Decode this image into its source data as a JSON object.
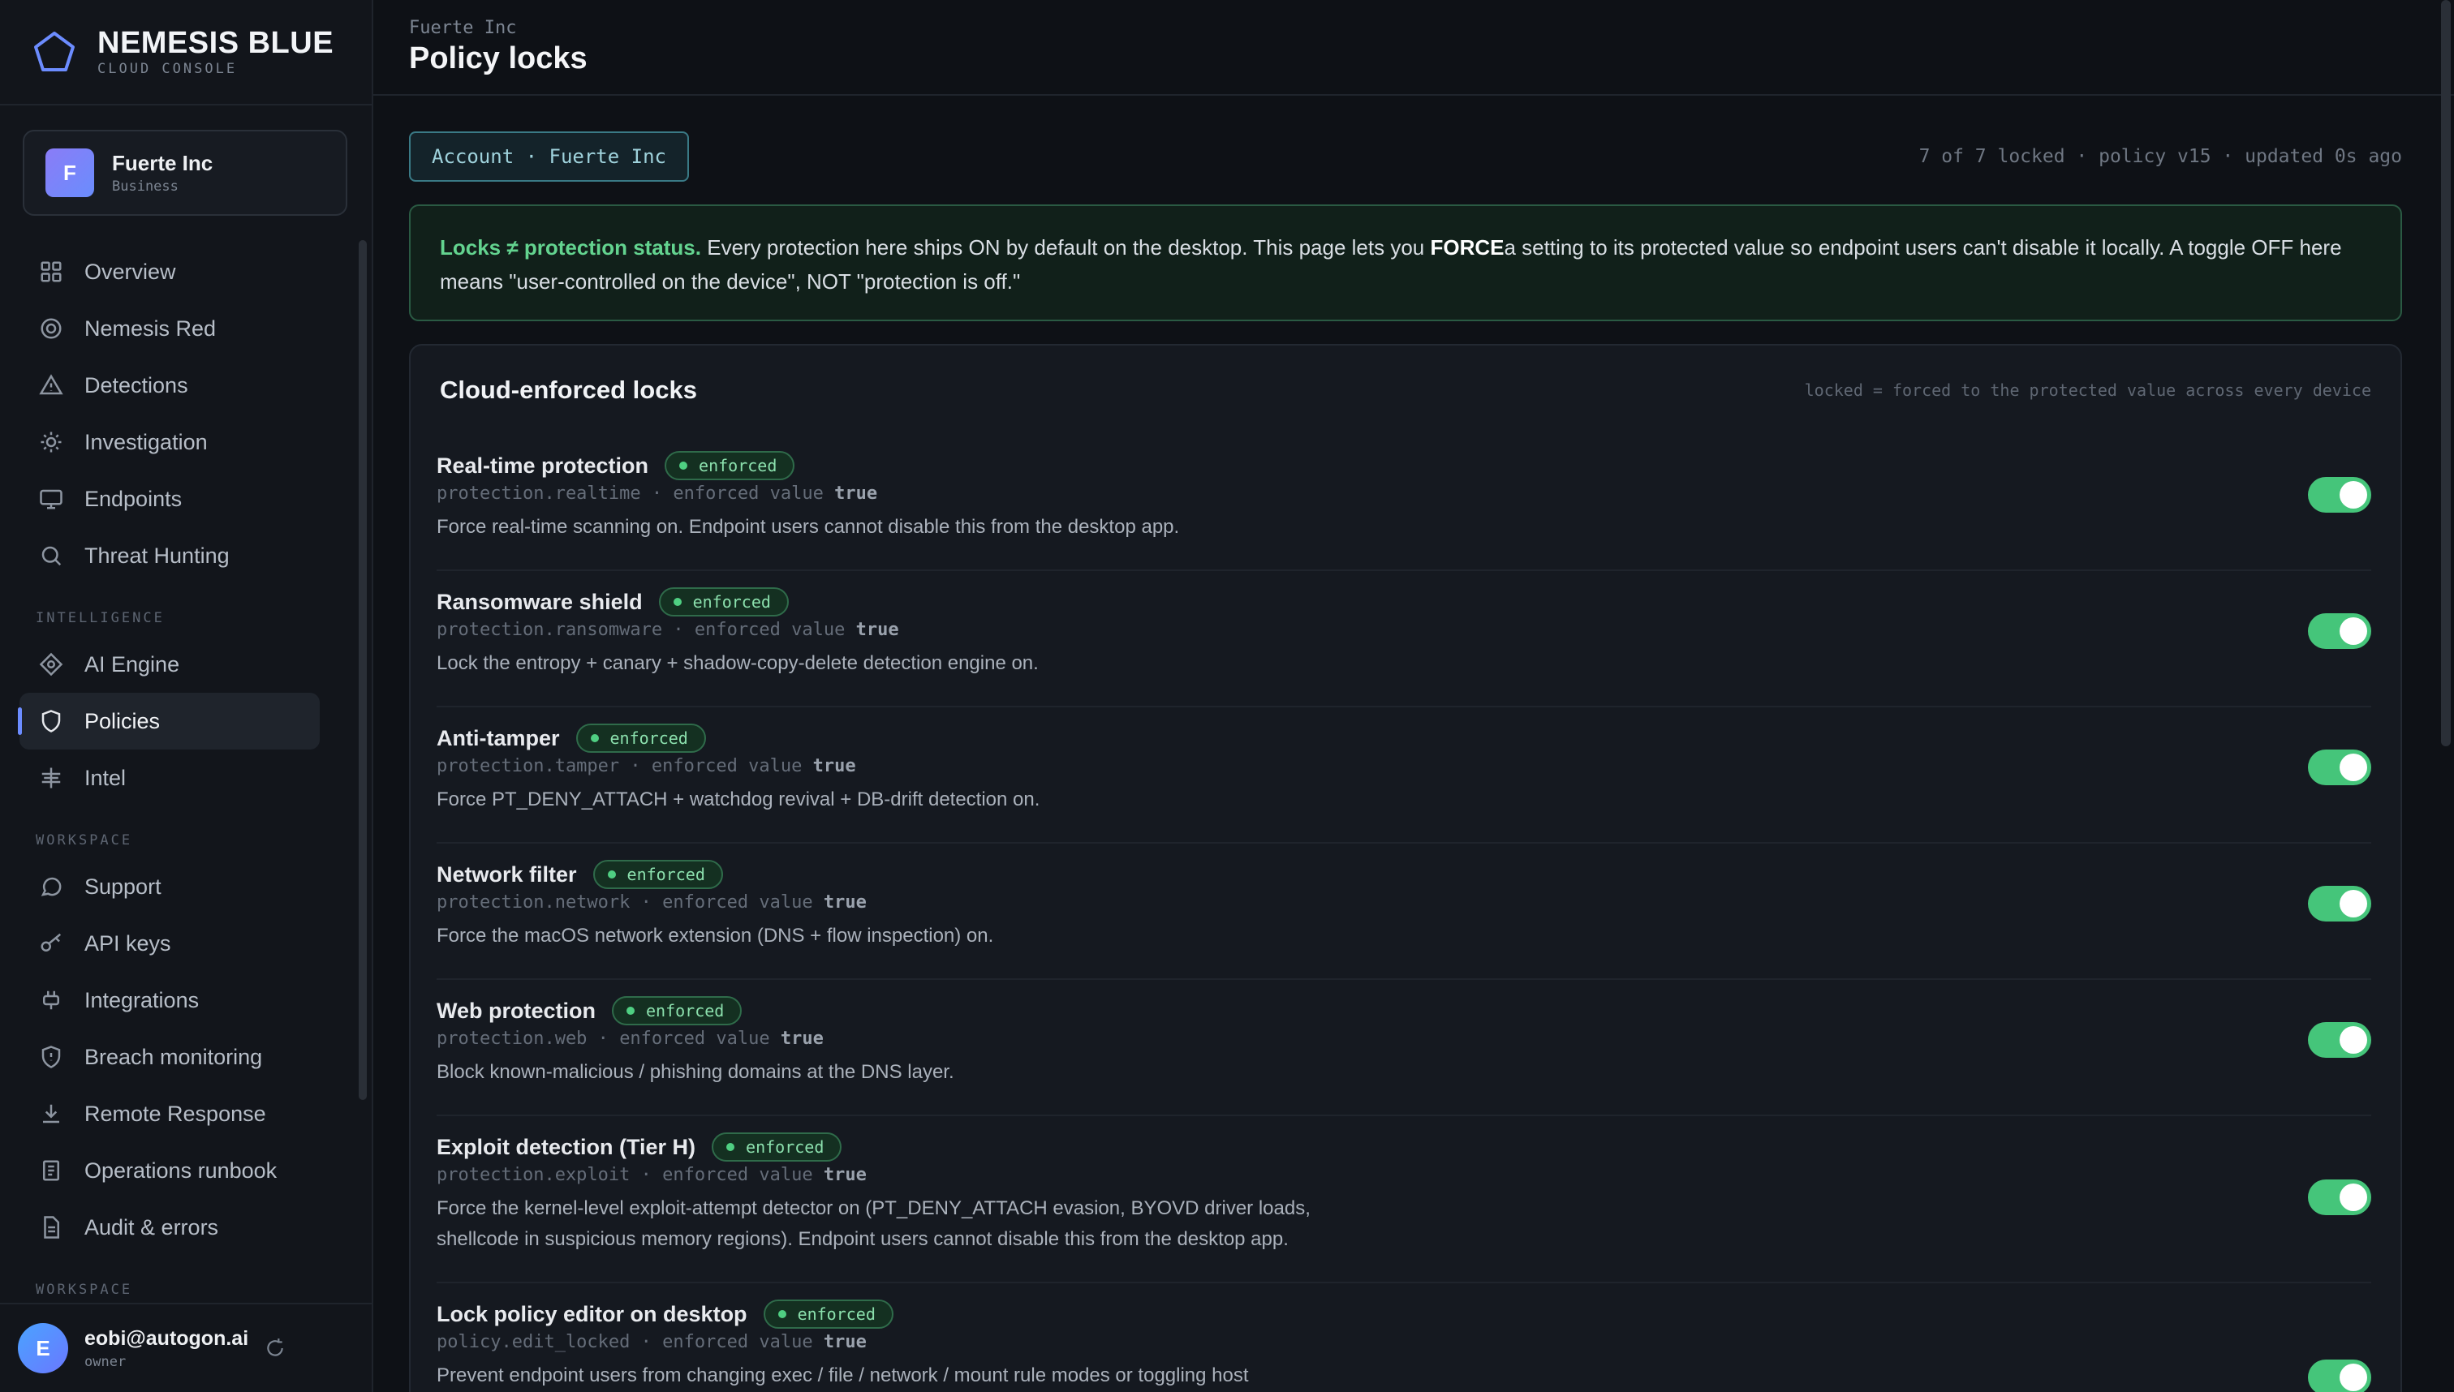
{
  "brand": {
    "name": "NEMESIS BLUE",
    "subtitle": "CLOUD CONSOLE"
  },
  "org": {
    "initial": "F",
    "name": "Fuerte Inc",
    "plan": "Business"
  },
  "nav": {
    "primary": [
      {
        "label": "Overview",
        "icon": "grid-icon"
      },
      {
        "label": "Nemesis Red",
        "icon": "target-icon"
      },
      {
        "label": "Detections",
        "icon": "warning-triangle-icon"
      },
      {
        "label": "Investigation",
        "icon": "bug-icon"
      },
      {
        "label": "Endpoints",
        "icon": "monitor-icon"
      },
      {
        "label": "Threat Hunting",
        "icon": "search-icon"
      }
    ],
    "intelligence_heading": "INTELLIGENCE",
    "intelligence": [
      {
        "label": "AI Engine",
        "icon": "diamond-icon"
      },
      {
        "label": "Policies",
        "icon": "shield-icon",
        "active": true
      },
      {
        "label": "Intel",
        "icon": "network-icon"
      }
    ],
    "workspace_heading": "WORKSPACE",
    "workspace": [
      {
        "label": "Support",
        "icon": "chat-icon"
      },
      {
        "label": "API keys",
        "icon": "key-icon"
      },
      {
        "label": "Integrations",
        "icon": "plug-icon"
      },
      {
        "label": "Breach monitoring",
        "icon": "shield-alert-icon"
      },
      {
        "label": "Remote Response",
        "icon": "download-icon"
      },
      {
        "label": "Operations runbook",
        "icon": "book-icon"
      },
      {
        "label": "Audit & errors",
        "icon": "document-icon"
      }
    ],
    "workspace_heading_2": "WORKSPACE"
  },
  "user": {
    "initial": "E",
    "email": "eobi@autogon.ai",
    "role": "owner"
  },
  "header": {
    "breadcrumb": "Fuerte Inc",
    "title": "Policy locks"
  },
  "scope": {
    "label": "Account · Fuerte Inc"
  },
  "status": {
    "text": "7 of 7 locked · policy v15 · updated 0s ago"
  },
  "notice": {
    "lead": "Locks ≠ protection status.",
    "part1": " Every protection here ships ON by default on the desktop. This page lets you ",
    "force": "FORCE",
    "part2": "a setting to its protected value so endpoint users can't disable it locally. A toggle OFF here means \"user-controlled on the device\", NOT \"protection is off.\""
  },
  "panel": {
    "title": "Cloud-enforced locks",
    "hint": "locked = forced to the protected value across every device",
    "enforced_label": "enforced",
    "value_label": "enforced value",
    "locks": [
      {
        "title": "Real-time protection",
        "key": "protection.realtime",
        "value": "true",
        "desc": "Force real-time scanning on. Endpoint users cannot disable this from the desktop app.",
        "on": true
      },
      {
        "title": "Ransomware shield",
        "key": "protection.ransomware",
        "value": "true",
        "desc": "Lock the entropy + canary + shadow-copy-delete detection engine on.",
        "on": true
      },
      {
        "title": "Anti-tamper",
        "key": "protection.tamper",
        "value": "true",
        "desc": "Force PT_DENY_ATTACH + watchdog revival + DB-drift detection on.",
        "on": true
      },
      {
        "title": "Network filter",
        "key": "protection.network",
        "value": "true",
        "desc": "Force the macOS network extension (DNS + flow inspection) on.",
        "on": true
      },
      {
        "title": "Web protection",
        "key": "protection.web",
        "value": "true",
        "desc": "Block known-malicious / phishing domains at the DNS layer.",
        "on": true
      },
      {
        "title": "Exploit detection (Tier H)",
        "key": "protection.exploit",
        "value": "true",
        "desc": "Force the kernel-level exploit-attempt detector on (PT_DENY_ATTACH evasion, BYOVD driver loads, shellcode in suspicious memory regions). Endpoint users cannot disable this from the desktop app.",
        "on": true
      },
      {
        "title": "Lock policy editor on desktop",
        "key": "policy.edit_locked",
        "value": "true",
        "desc": "Prevent endpoint users from changing exec / file / network / mount rule modes or toggling host",
        "on": true
      }
    ]
  },
  "colors": {
    "accent": "#6c8cff",
    "toggle_on": "#45c57a",
    "enforced": "#8be0ad",
    "notice_border": "#2a5a43"
  }
}
